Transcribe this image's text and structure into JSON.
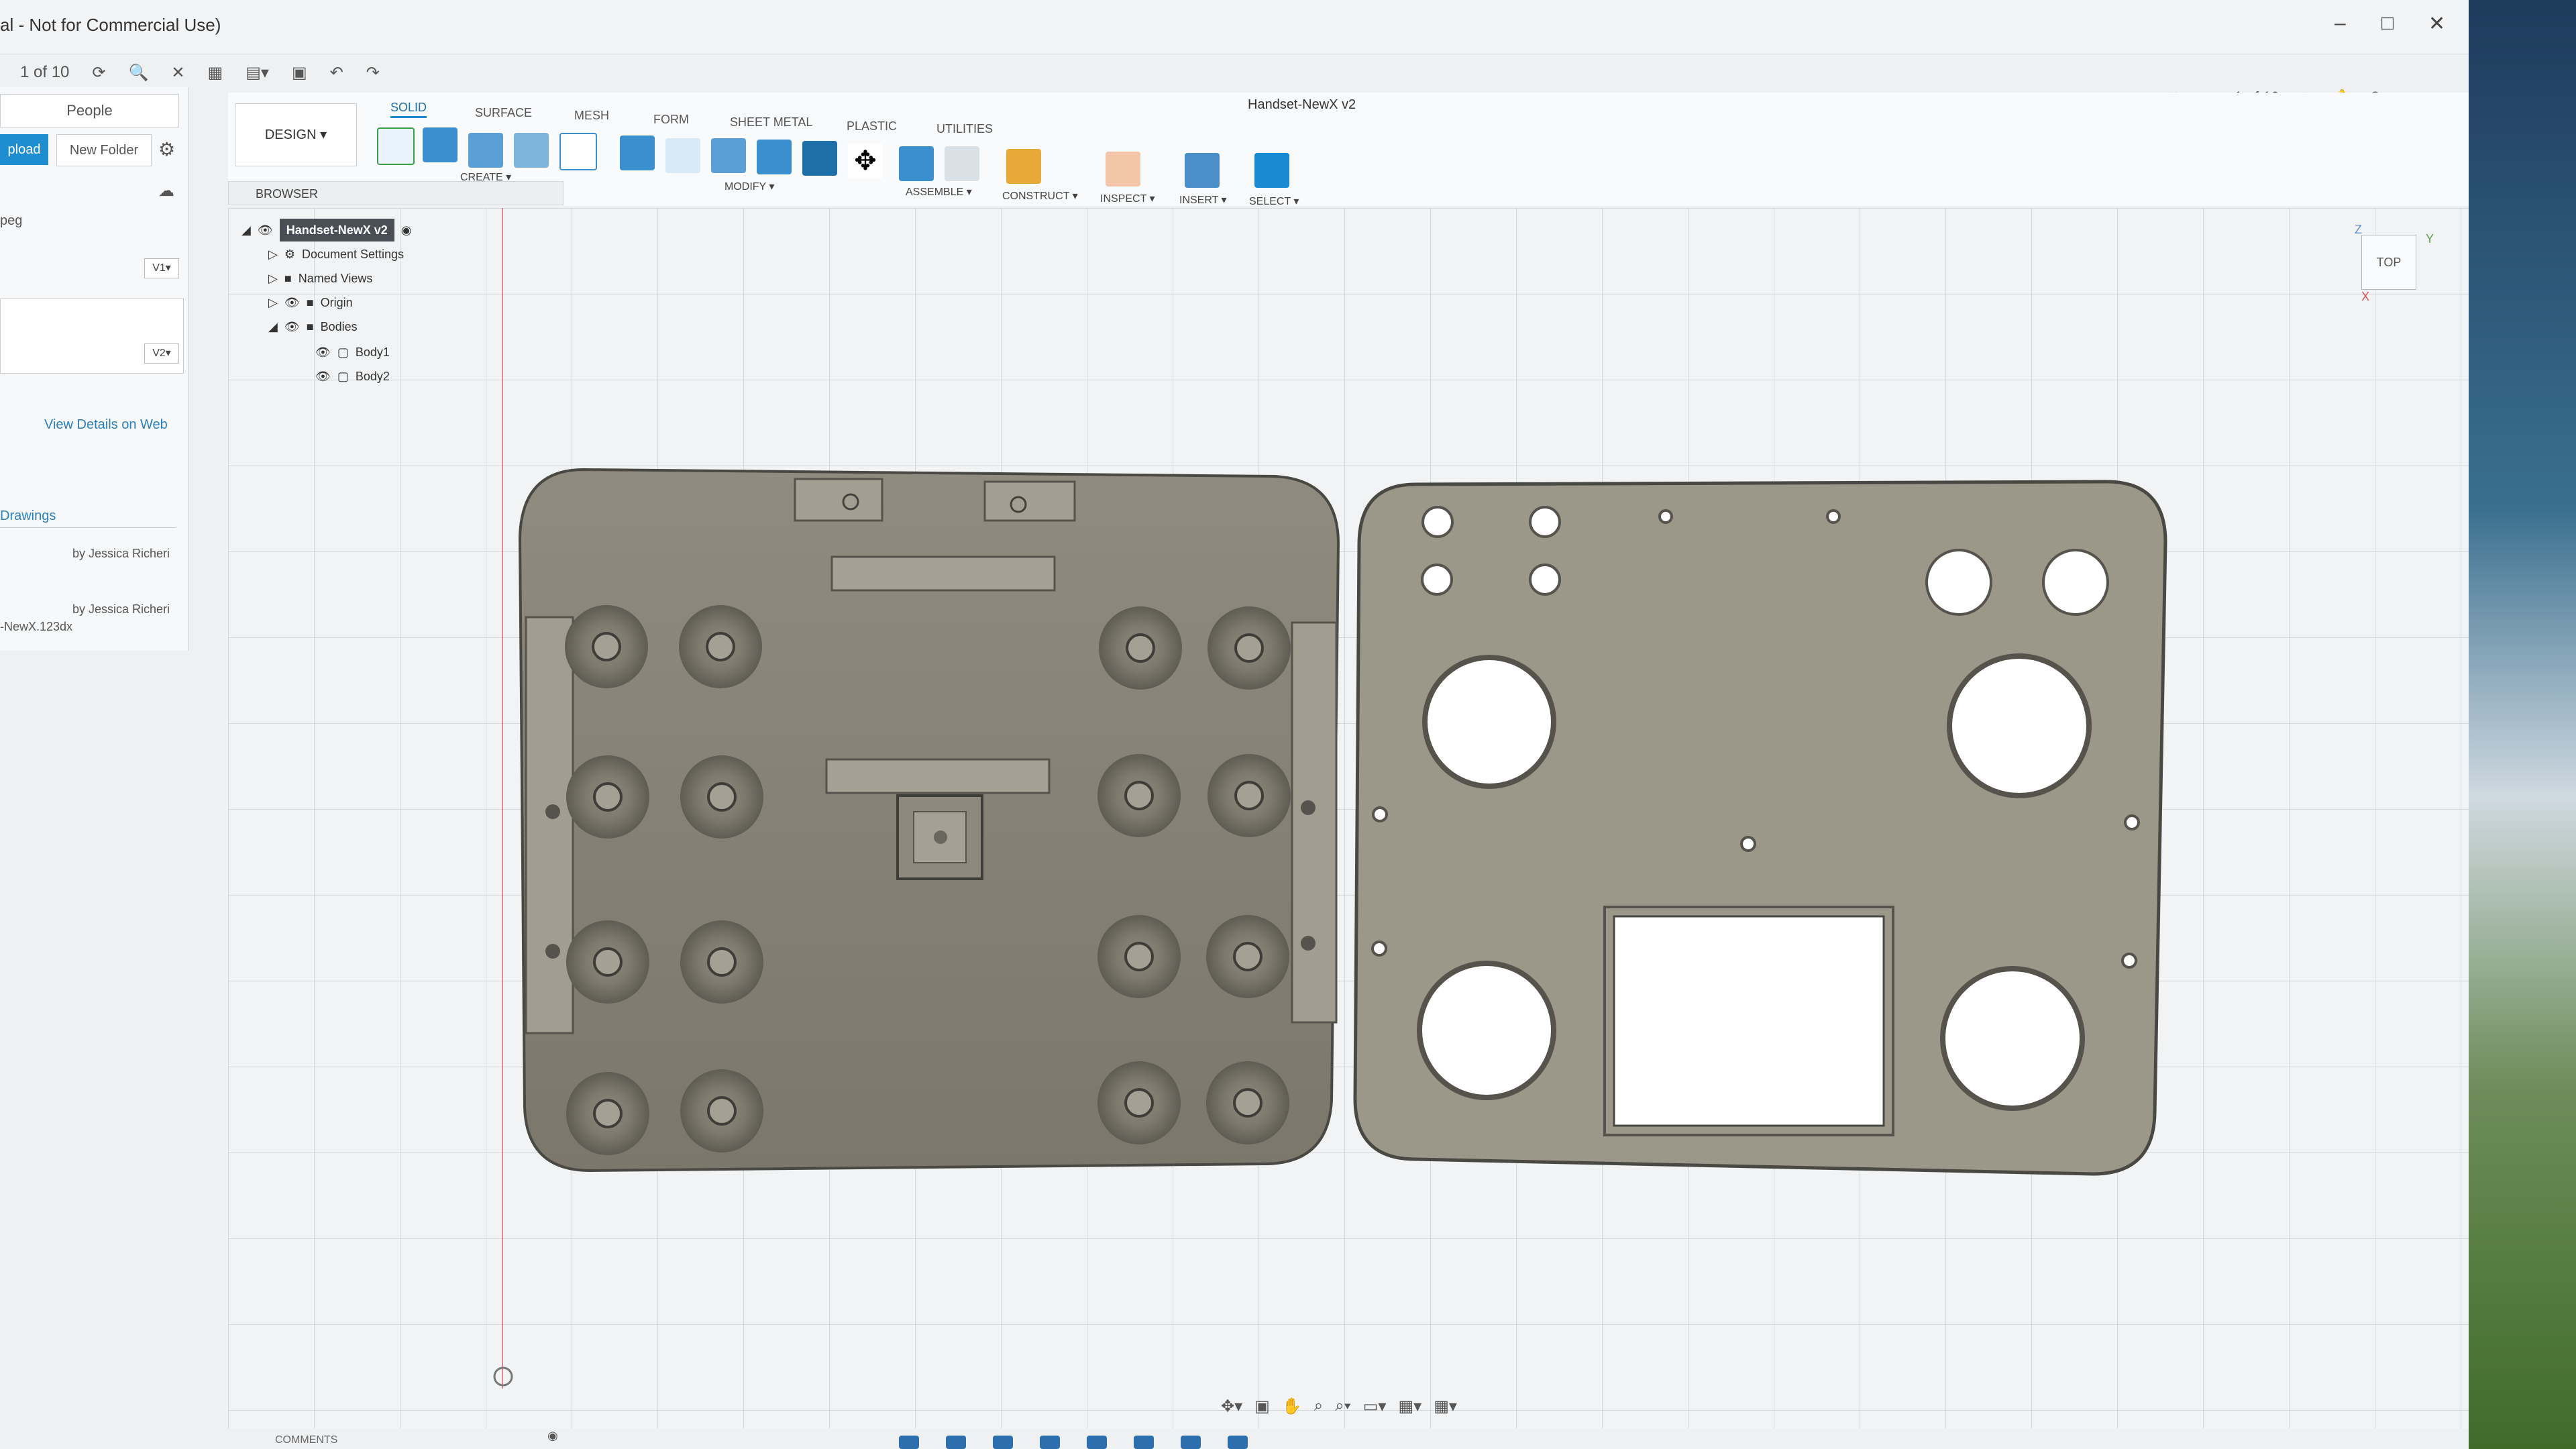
{
  "window": {
    "title": "al - Not for Commercial Use)",
    "controls": [
      "–",
      "□",
      "✕"
    ]
  },
  "quick_access": {
    "page_indicator": "1 of 10",
    "right_page_indicator": "1 of 10"
  },
  "left_panel": {
    "people": "People",
    "upload": "pload",
    "new_folder": "New Folder",
    "file_ext": "peg",
    "version_1": "V1▾",
    "version_2": "V2▾",
    "view_details": "View Details on Web",
    "drawings": "Drawings",
    "by_1": "by Jessica Richeri",
    "by_2": "by Jessica Richeri",
    "file_name": "-NewX.123dx"
  },
  "toolbar": {
    "design_label": "DESIGN ▾",
    "tabs": [
      "SOLID",
      "SURFACE",
      "MESH",
      "FORM",
      "SHEET METAL",
      "PLASTIC",
      "UTILITIES"
    ],
    "groups": [
      "CREATE ▾",
      "MODIFY ▾",
      "ASSEMBLE ▾",
      "CONSTRUCT ▾",
      "INSPECT ▾",
      "INSERT ▾",
      "SELECT ▾"
    ]
  },
  "document_tab": "Handset-NewX v2",
  "browser": {
    "title": "BROWSER",
    "root": "Handset-NewX v2",
    "items": [
      "Document Settings",
      "Named Views",
      "Origin",
      "Bodies",
      "Body1",
      "Body2"
    ]
  },
  "viewcube": {
    "face": "TOP",
    "axis_z": "Z",
    "axis_x": "X",
    "axis_y": "Y"
  },
  "bottom": {
    "comments": "COMMENTS"
  },
  "colors": {
    "accent": "#1c8ad0",
    "body_fill": "#9b9789",
    "grid": "#d6d9dc"
  }
}
